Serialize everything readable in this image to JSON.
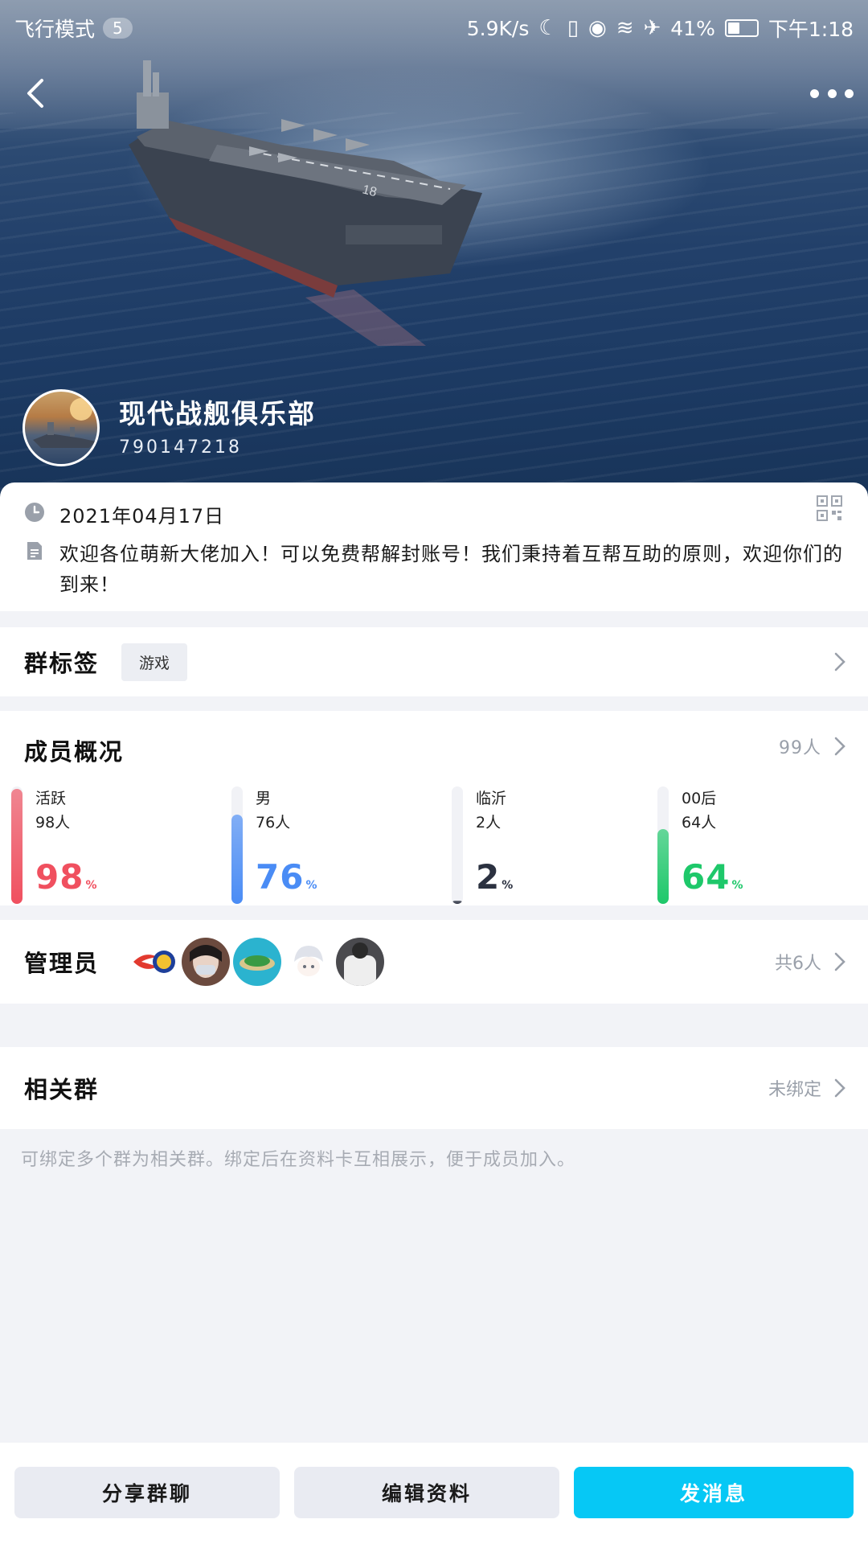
{
  "status_bar": {
    "mode_label": "飞行模式",
    "notification_count": "5",
    "network_speed": "5.9K/s",
    "battery_percent": "41%",
    "time": "下午1:18"
  },
  "group": {
    "name": "现代战舰俱乐部",
    "id": "790147218",
    "created_date": "2021年04月17日",
    "intro": "欢迎各位萌新大佬加入！可以免费帮解封账号！我们秉持着互帮互助的原则，欢迎你们的到来！"
  },
  "tags": {
    "title": "群标签",
    "items": [
      "游戏"
    ]
  },
  "members": {
    "title": "成员概况",
    "total": "99人",
    "stats": [
      {
        "label": "活跃",
        "count": "98人",
        "percent": "98",
        "unit": "%",
        "value": 0.98,
        "color": "#f0505f"
      },
      {
        "label": "男",
        "count": "76人",
        "percent": "76",
        "unit": "%",
        "value": 0.76,
        "color": "#4a8cf5"
      },
      {
        "label": "临沂",
        "count": "2人",
        "percent": "2",
        "unit": "%",
        "value": 0.02,
        "color": "#2b3140"
      },
      {
        "label": "00后",
        "count": "64人",
        "percent": "64",
        "unit": "%",
        "value": 0.64,
        "color": "#1ec86a"
      }
    ]
  },
  "admins": {
    "title": "管理员",
    "count": "共6人"
  },
  "related": {
    "title": "相关群",
    "status": "未绑定",
    "note": "可绑定多个群为相关群。绑定后在资料卡互相展示，便于成员加入。"
  },
  "actions": {
    "share": "分享群聊",
    "edit": "编辑资料",
    "message": "发消息"
  },
  "colors": {
    "primary": "#06c8f5",
    "secondary_button": "#e9ebf2",
    "page_bg": "#f2f3f7"
  }
}
